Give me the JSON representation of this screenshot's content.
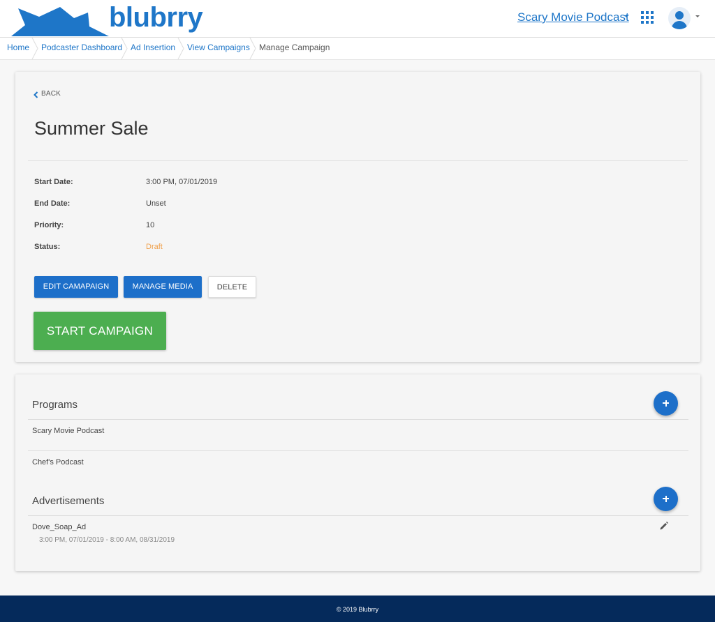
{
  "header": {
    "brand": "blubrry",
    "podcast_selector": "Scary Movie Podcast",
    "colors": {
      "brand_blue": "#1e76c8",
      "footer_navy": "#052a5b"
    }
  },
  "breadcrumb": [
    "Home",
    "Podcaster Dashboard",
    "Ad Insertion",
    "View Campaigns",
    "Manage Campaign"
  ],
  "campaign": {
    "back_label": "BACK",
    "title": "Summer Sale",
    "fields": [
      {
        "label": "Start Date:",
        "value": "3:00 PM, 07/01/2019"
      },
      {
        "label": "End Date:",
        "value": "Unset"
      },
      {
        "label": "Priority:",
        "value": "10"
      },
      {
        "label": "Status:",
        "value": "Draft"
      }
    ],
    "buttons": {
      "edit": "EDIT CAMAPAIGN",
      "manage_media": "MANAGE MEDIA",
      "delete": "DELETE",
      "start": "START CAMPAIGN"
    },
    "status_color": "#f0a04b",
    "start_color": "#4cae50"
  },
  "programs": {
    "title": "Programs",
    "items": [
      "Scary Movie Podcast",
      "Chef's Podcast"
    ]
  },
  "advertisements": {
    "title": "Advertisements",
    "items": [
      {
        "name": "Dove_Soap_Ad",
        "range": "3:00 PM, 07/01/2019 - 8:00 AM, 08/31/2019"
      }
    ]
  },
  "footer": {
    "text": "© 2019 Blubrry"
  }
}
